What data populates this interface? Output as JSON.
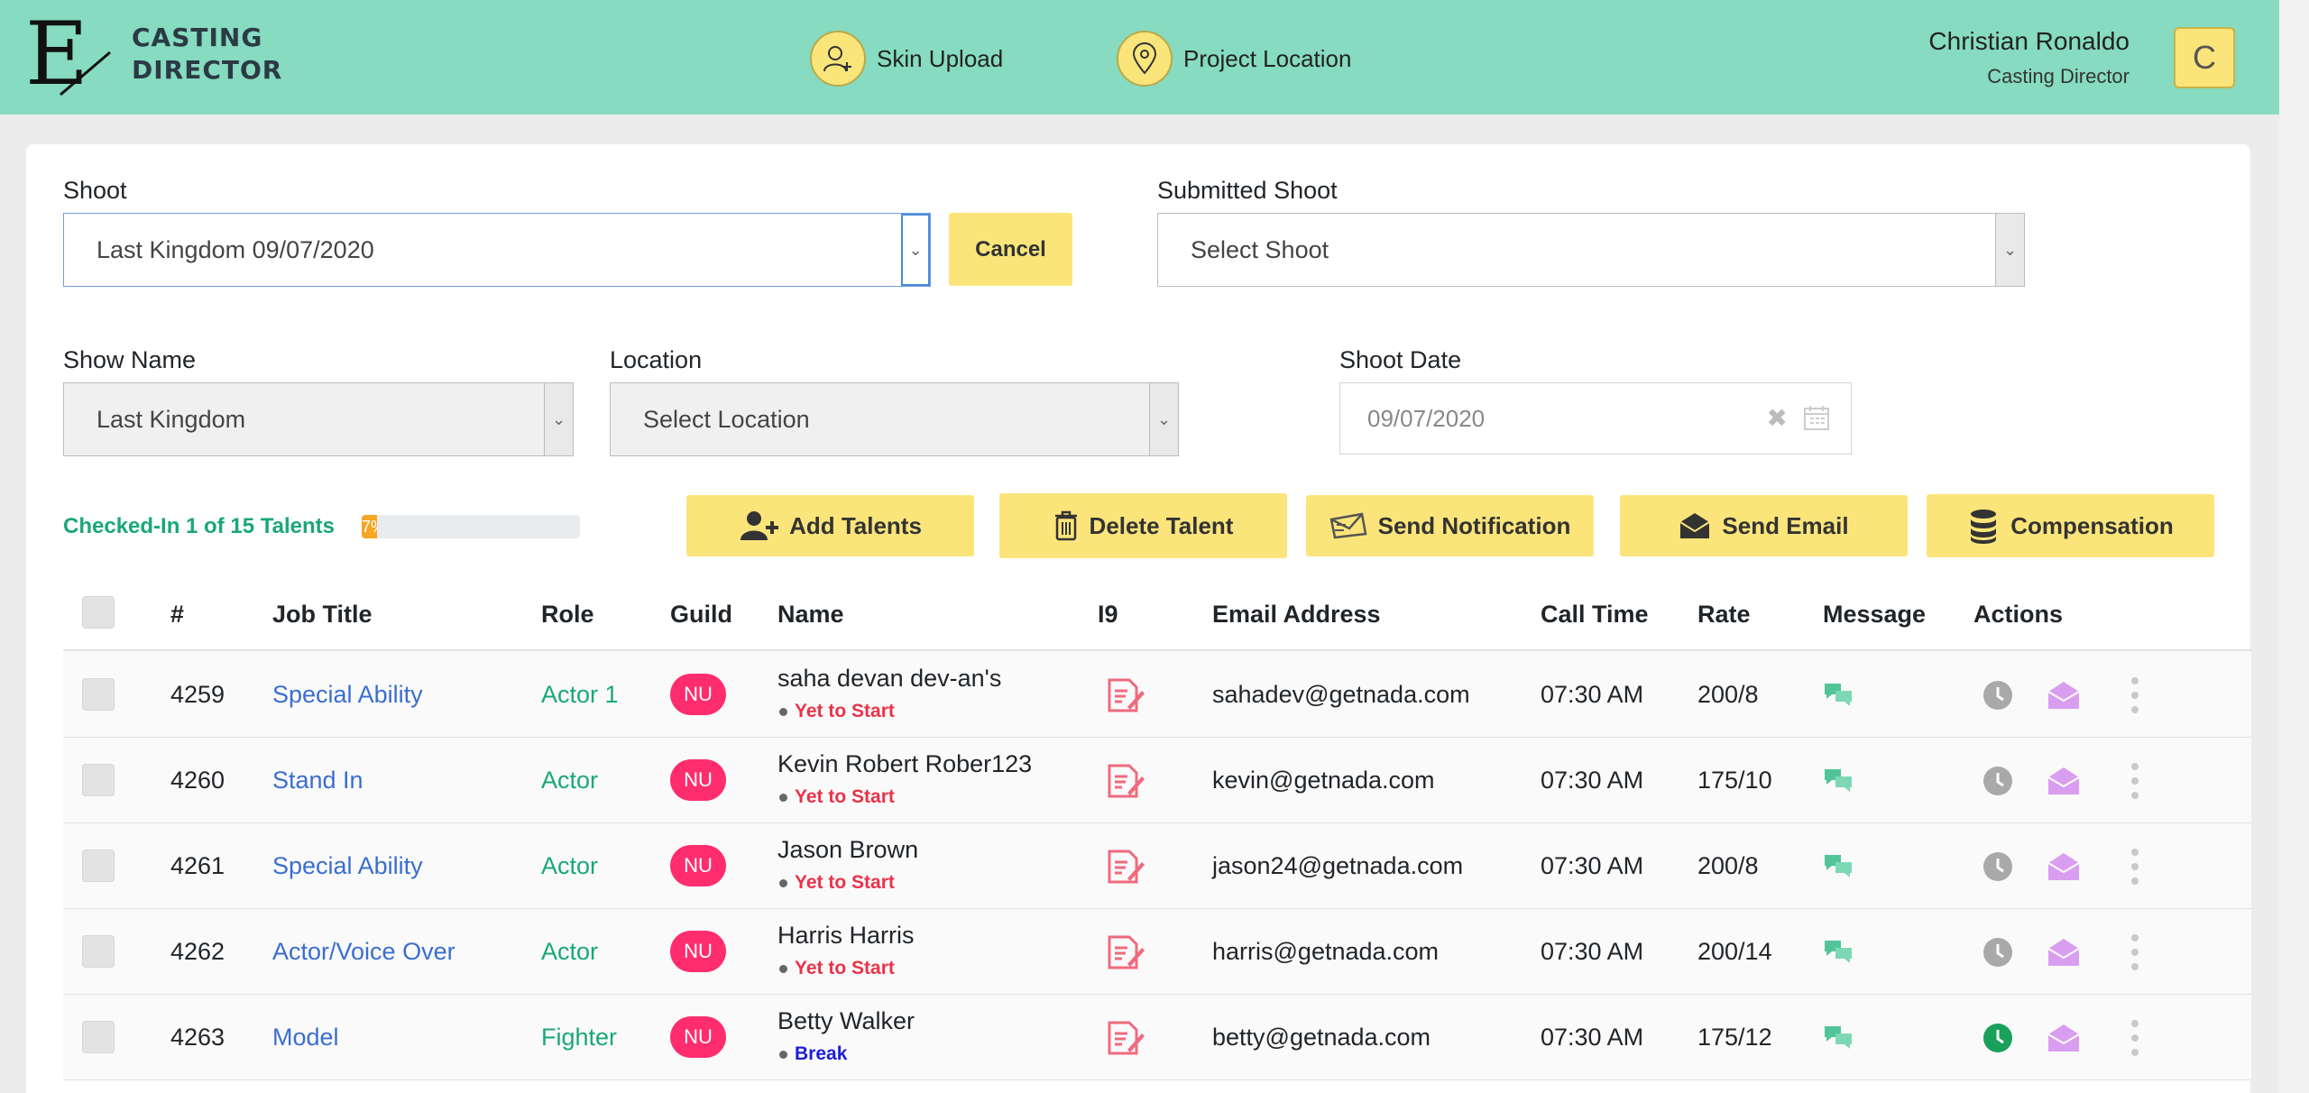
{
  "header": {
    "logo_letter": "E",
    "logo_line1": "CASTING",
    "logo_line2": "DIRECTOR",
    "nav": [
      {
        "label": "Skin Upload",
        "icon": "user-plus-icon"
      },
      {
        "label": "Project Location",
        "icon": "map-pin-icon"
      }
    ],
    "user_name": "Christian Ronaldo",
    "user_role": "Casting Director",
    "avatar_initial": "C"
  },
  "form": {
    "shoot_label": "Shoot",
    "shoot_value": "Last Kingdom 09/07/2020",
    "cancel_label": "Cancel",
    "submitted_label": "Submitted Shoot",
    "submitted_value": "Select Shoot",
    "show_label": "Show Name",
    "show_value": "Last Kingdom",
    "location_label": "Location",
    "location_value": "Select Location",
    "date_label": "Shoot Date",
    "date_value": "09/07/2020"
  },
  "checkin": {
    "text": "Checked-In 1 of 15 Talents",
    "progress_label": "7%",
    "progress_fraction": 0.07
  },
  "actions": {
    "add": "Add Talents",
    "delete": "Delete Talent",
    "notify": "Send Notification",
    "email": "Send Email",
    "comp": "Compensation"
  },
  "table": {
    "headers": [
      "#",
      "Job Title",
      "Role",
      "Guild",
      "Name",
      "I9",
      "Email Address",
      "Call Time",
      "Rate",
      "Message",
      "Actions"
    ],
    "rows": [
      {
        "id": "4259",
        "job": "Special Ability",
        "role": "Actor 1",
        "guild": "NU",
        "name": "saha devan dev-an's",
        "status": "Yet to Start",
        "status_color": "#e8334a",
        "email": "sahadev@getnada.com",
        "call": "07:30 AM",
        "rate": "200/8",
        "clock_color": "#a9a9a9"
      },
      {
        "id": "4260",
        "job": "Stand In",
        "role": "Actor",
        "guild": "NU",
        "name": "Kevin Robert Rober123",
        "status": "Yet to Start",
        "status_color": "#e8334a",
        "email": "kevin@getnada.com",
        "call": "07:30 AM",
        "rate": "175/10",
        "clock_color": "#a9a9a9"
      },
      {
        "id": "4261",
        "job": "Special Ability",
        "role": "Actor",
        "guild": "NU",
        "name": "Jason Brown",
        "status": "Yet to Start",
        "status_color": "#e8334a",
        "email": "jason24@getnada.com",
        "call": "07:30 AM",
        "rate": "200/8",
        "clock_color": "#a9a9a9"
      },
      {
        "id": "4262",
        "job": "Actor/Voice Over",
        "role": "Actor",
        "guild": "NU",
        "name": "Harris Harris",
        "status": "Yet to Start",
        "status_color": "#e8334a",
        "email": "harris@getnada.com",
        "call": "07:30 AM",
        "rate": "200/14",
        "clock_color": "#a9a9a9"
      },
      {
        "id": "4263",
        "job": "Model",
        "role": "Fighter",
        "guild": "NU",
        "name": "Betty Walker",
        "status": "Break",
        "status_color": "#1d1dd8",
        "email": "betty@getnada.com",
        "call": "07:30 AM",
        "rate": "175/12",
        "clock_color": "#19a05a"
      }
    ]
  },
  "colors": {
    "header_bg": "#86dbc0",
    "accent_yellow": "#fbe57a",
    "guild_pink": "#ff2d6e",
    "link_blue": "#3a6ed0",
    "role_green": "#1aa876"
  }
}
